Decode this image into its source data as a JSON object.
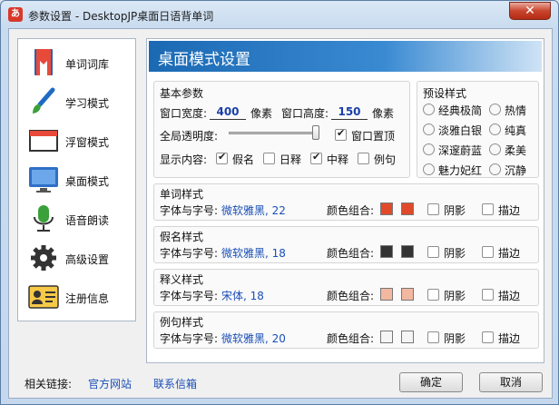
{
  "window": {
    "title": "参数设置 - DesktopJP桌面日语背单词",
    "app_icon": "あ",
    "close": "✕"
  },
  "sidebar": {
    "items": [
      {
        "label": "单词词库",
        "icon": "book-icon"
      },
      {
        "label": "学习模式",
        "icon": "brush-icon"
      },
      {
        "label": "浮窗模式",
        "icon": "window-icon"
      },
      {
        "label": "桌面模式",
        "icon": "monitor-icon"
      },
      {
        "label": "语音朗读",
        "icon": "microphone-icon"
      },
      {
        "label": "高级设置",
        "icon": "gear-icon"
      },
      {
        "label": "注册信息",
        "icon": "id-card-icon"
      }
    ]
  },
  "main": {
    "title": "桌面模式设置"
  },
  "basic": {
    "title": "基本参数",
    "width_label": "窗口宽度:",
    "width_value": "400",
    "width_unit": "像素",
    "height_label": "窗口高度:",
    "height_value": "150",
    "height_unit": "像素",
    "opacity_label": "全局透明度:",
    "opacity_level": 0.95,
    "topmost_label": "窗口置顶",
    "topmost": true,
    "display_label": "显示内容:",
    "display": [
      {
        "label": "假名",
        "checked": true
      },
      {
        "label": "日释",
        "checked": false
      },
      {
        "label": "中释",
        "checked": true
      },
      {
        "label": "例句",
        "checked": false
      }
    ]
  },
  "presets": {
    "title": "预设样式",
    "items": [
      "经典极简",
      "热情",
      "淡雅白银",
      "纯真",
      "深邃蔚蓝",
      "柔美",
      "魅力妃红",
      "沉静"
    ]
  },
  "styles": [
    {
      "title": "单词样式",
      "font_label": "字体与字号:",
      "font_value": "微软雅黑, 22",
      "font_blue": true,
      "color_label": "颜色组合:",
      "colors": [
        "#e04a2a",
        "#e04a2a"
      ],
      "shadow": "阴影",
      "outline": "描边"
    },
    {
      "title": "假名样式",
      "font_label": "字体与字号:",
      "font_value": "微软雅黑, 18",
      "font_blue": true,
      "color_label": "颜色组合:",
      "colors": [
        "#333333",
        "#333333"
      ],
      "shadow": "阴影",
      "outline": "描边"
    },
    {
      "title": "释义样式",
      "font_label": "字体与字号:",
      "font_value": "宋体, 18",
      "font_blue": true,
      "color_label": "颜色组合:",
      "colors": [
        "#f2b8a0",
        "#f2b8a0"
      ],
      "shadow": "阴影",
      "outline": "描边"
    },
    {
      "title": "例句样式",
      "font_label": "字体与字号:",
      "font_value": "微软雅黑, 20",
      "font_blue": true,
      "color_label": "颜色组合:",
      "colors": [
        "#f5f5f5",
        "#f5f5f5"
      ],
      "shadow": "阴影",
      "outline": "描边"
    }
  ],
  "footer": {
    "links_label": "相关链接:",
    "link1": "官方网站",
    "link2": "联系信箱",
    "ok": "确定",
    "cancel": "取消"
  }
}
